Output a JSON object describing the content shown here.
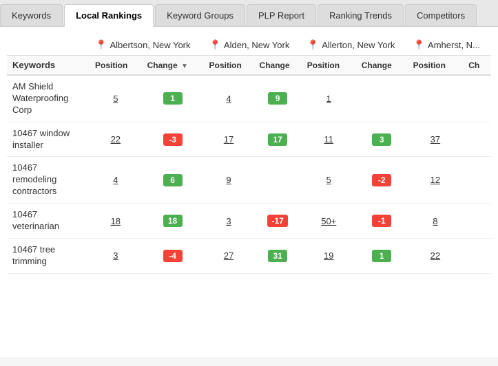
{
  "tabs": [
    {
      "label": "Keywords",
      "active": false
    },
    {
      "label": "Local Rankings",
      "active": true
    },
    {
      "label": "Keyword Groups",
      "active": false
    },
    {
      "label": "PLP Report",
      "active": false
    },
    {
      "label": "Ranking Trends",
      "active": false
    },
    {
      "label": "Competitors",
      "active": false
    }
  ],
  "locations": [
    {
      "name": "Albertson, New York"
    },
    {
      "name": "Alden, New York"
    },
    {
      "name": "Allerton, New York"
    },
    {
      "name": "Amherst, N..."
    }
  ],
  "columns": {
    "keyword_label": "Keywords",
    "position_label": "Position",
    "change_label": "Change"
  },
  "rows": [
    {
      "keyword": "AM Shield Waterproofing Corp",
      "albertson_pos": "5",
      "albertson_change": "1",
      "albertson_change_type": "positive",
      "alden_pos": "4",
      "alden_change": "9",
      "alden_change_type": "positive",
      "allerton_pos": "1",
      "allerton_change": "",
      "allerton_change_type": "",
      "amherst_pos": "",
      "amherst_change": "",
      "amherst_change_type": ""
    },
    {
      "keyword": "10467 window installer",
      "albertson_pos": "22",
      "albertson_change": "-3",
      "albertson_change_type": "negative",
      "alden_pos": "17",
      "alden_change": "17",
      "alden_change_type": "positive",
      "allerton_pos": "11",
      "allerton_change": "3",
      "allerton_change_type": "positive",
      "amherst_pos": "37",
      "amherst_change": "",
      "amherst_change_type": ""
    },
    {
      "keyword": "10467 remodeling contractors",
      "albertson_pos": "4",
      "albertson_change": "6",
      "albertson_change_type": "positive",
      "alden_pos": "9",
      "alden_change": "",
      "alden_change_type": "",
      "allerton_pos": "5",
      "allerton_change": "-2",
      "allerton_change_type": "negative",
      "amherst_pos": "12",
      "amherst_change": "",
      "amherst_change_type": ""
    },
    {
      "keyword": "10467 veterinarian",
      "albertson_pos": "18",
      "albertson_change": "18",
      "albertson_change_type": "positive",
      "alden_pos": "3",
      "alden_change": "-17",
      "alden_change_type": "negative",
      "allerton_pos": "50+",
      "allerton_change": "-1",
      "allerton_change_type": "negative",
      "amherst_pos": "8",
      "amherst_change": "",
      "amherst_change_type": ""
    },
    {
      "keyword": "10467 tree trimming",
      "albertson_pos": "3",
      "albertson_change": "-4",
      "albertson_change_type": "negative",
      "alden_pos": "27",
      "alden_change": "31",
      "alden_change_type": "positive",
      "allerton_pos": "19",
      "allerton_change": "1",
      "allerton_change_type": "positive",
      "amherst_pos": "22",
      "amherst_change": "",
      "amherst_change_type": ""
    }
  ]
}
